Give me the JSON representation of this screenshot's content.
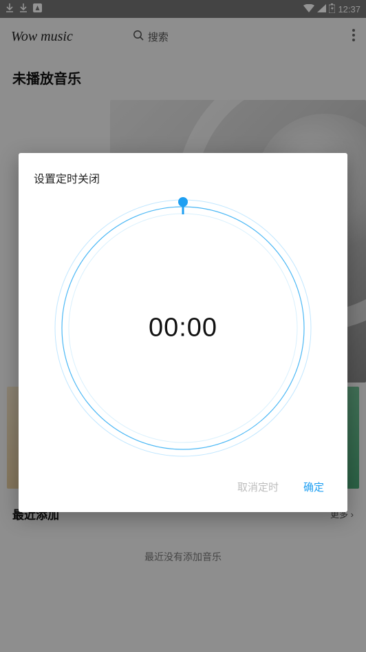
{
  "status": {
    "time": "12:37"
  },
  "appbar": {
    "title": "Wow music",
    "search_label": "搜索"
  },
  "heading": "未播放音乐",
  "section": {
    "title": "最近添加",
    "more": "更多",
    "empty": "最近没有添加音乐"
  },
  "dialog": {
    "title": "设置定时关闭",
    "time": "00:00",
    "cancel": "取消定时",
    "ok": "确定"
  },
  "colors": {
    "accent": "#1e9ff2"
  }
}
